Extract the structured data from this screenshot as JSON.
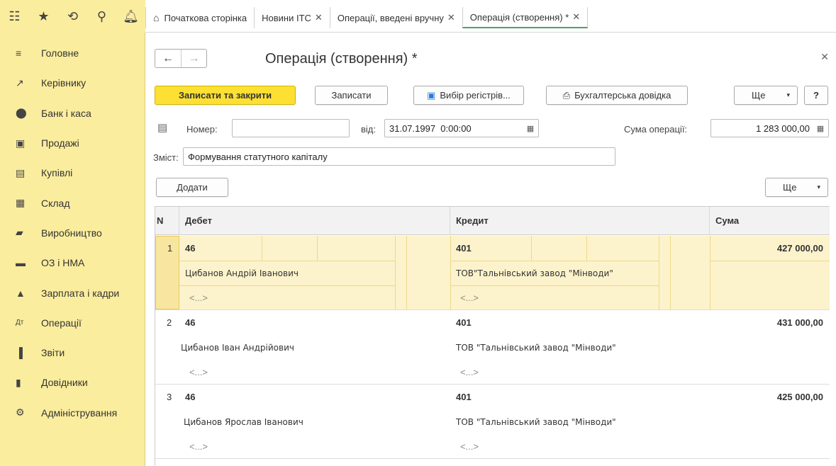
{
  "topbar": {
    "icons": [
      "apps-grid-icon",
      "star-icon",
      "history-icon",
      "search-icon",
      "bell-icon"
    ],
    "tabs": [
      {
        "label": "Початкова сторінка",
        "home": true
      },
      {
        "label": "Новини ІТС",
        "closable": true
      },
      {
        "label": "Операції, введені вручну",
        "closable": true
      },
      {
        "label": "Операція (створення) *",
        "closable": true,
        "active": true
      }
    ]
  },
  "sidebar": {
    "items": [
      {
        "label": "Головне",
        "icon": "menu-lines-icon"
      },
      {
        "label": "Керівнику",
        "icon": "trend-icon"
      },
      {
        "label": "Банк і каса",
        "icon": "money-icon"
      },
      {
        "label": "Продажі",
        "icon": "bag-icon"
      },
      {
        "label": "Купівлі",
        "icon": "cart-icon"
      },
      {
        "label": "Склад",
        "icon": "warehouse-icon"
      },
      {
        "label": "Виробництво",
        "icon": "factory-icon"
      },
      {
        "label": "ОЗ і НМА",
        "icon": "truck-icon"
      },
      {
        "label": "Зарплата і кадри",
        "icon": "person-icon"
      },
      {
        "label": "Операції",
        "icon": "dt-kt-icon"
      },
      {
        "label": "Звіти",
        "icon": "bar-chart-icon"
      },
      {
        "label": "Довідники",
        "icon": "book-icon"
      },
      {
        "label": "Адміністрування",
        "icon": "gear-icon"
      }
    ]
  },
  "form": {
    "title": "Операція (створення) *",
    "buttons": {
      "save_close": "Записати та закрити",
      "save": "Записати",
      "registers": "Вибір регістрів...",
      "accounting_ref": "Бухгалтерська довідка",
      "more": "Ще",
      "help": "?",
      "add": "Додати",
      "more2": "Ще"
    },
    "number_label": "Номер:",
    "number_value": "",
    "date_label": "від:",
    "date_value": "31.07.1997  0:00:00",
    "sum_label": "Сума операції:",
    "sum_value": "1 283 000,00",
    "content_label": "Зміст:",
    "content_value": "Формування статутного капіталу"
  },
  "table": {
    "headers": [
      "N",
      "Дебет",
      "Кредит",
      "Сума"
    ],
    "rows": [
      {
        "n": "1",
        "debit": "46",
        "debit_sub1": "Цибанов Андрій Іванович",
        "debit_sub2": "<...>",
        "credit": "401",
        "credit_sub1": "ТОВ\"Тальнівський завод \"Мінводи\"",
        "credit_sub2": "<...>",
        "sum": "427 000,00"
      },
      {
        "n": "2",
        "debit": "46",
        "debit_sub1": "Цибанов Іван Андрійович",
        "debit_sub2": "<...>",
        "credit": "401",
        "credit_sub1": "ТОВ \"Тальнівський завод \"Мінводи\"",
        "credit_sub2": "<...>",
        "sum": "431 000,00"
      },
      {
        "n": "3",
        "debit": "46",
        "debit_sub1": "Цибанов Ярослав Іванович",
        "debit_sub2": "<...>",
        "credit": "401",
        "credit_sub1": "ТОВ \"Тальнівський завод \"Мінводи\"",
        "credit_sub2": "<...>",
        "sum": "425 000,00"
      }
    ]
  },
  "colors": {
    "accent_yellow": "#fde033",
    "sidebar_bg": "#fbed9e",
    "selected_row": "#fcf3cc",
    "active_tab_underline": "#4aa35e"
  }
}
